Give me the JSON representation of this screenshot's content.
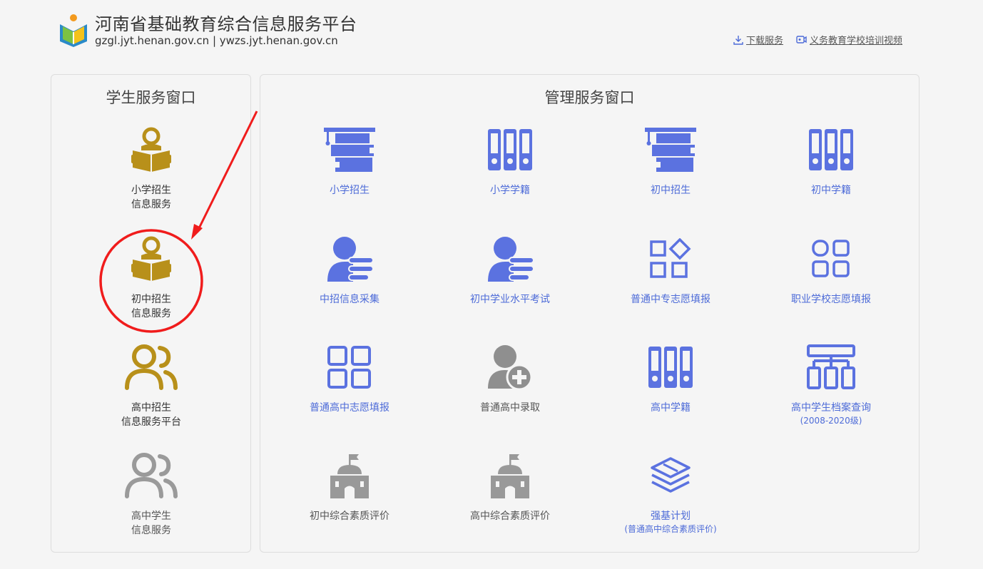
{
  "header": {
    "title": "河南省基础教育综合信息服务平台",
    "domains": "gzgl.jyt.henan.gov.cn | ywzs.jyt.henan.gov.cn",
    "links": [
      {
        "label": "下载服务",
        "icon": "download-icon"
      },
      {
        "label": "义务教育学校培训视频",
        "icon": "video-icon"
      }
    ]
  },
  "student_panel": {
    "title": "学生服务窗口",
    "items": [
      {
        "line1": "小学招生",
        "line2": "信息服务",
        "icon": "reader-icon",
        "color": "#b8901a"
      },
      {
        "line1": "初中招生",
        "line2": "信息服务",
        "icon": "reader-icon",
        "color": "#b8901a"
      },
      {
        "line1": "高中招生",
        "line2": "信息服务平台",
        "icon": "users-icon",
        "color": "#b8901a"
      },
      {
        "line1": "高中学生",
        "line2": "信息服务",
        "icon": "users-icon",
        "color": "#9a9a9a"
      }
    ]
  },
  "manage_panel": {
    "title": "管理服务窗口",
    "items": [
      {
        "label": "小学招生",
        "icon": "graduation-books-icon"
      },
      {
        "label": "小学学籍",
        "icon": "binders-icon"
      },
      {
        "label": "初中招生",
        "icon": "graduation-books-icon"
      },
      {
        "label": "初中学籍",
        "icon": "binders-icon"
      },
      {
        "label": "中招信息采集",
        "icon": "user-list-icon"
      },
      {
        "label": "初中学业水平考试",
        "icon": "user-list-icon"
      },
      {
        "label": "普通中专志愿填报",
        "icon": "shapes-icon"
      },
      {
        "label": "职业学校志愿填报",
        "icon": "squares-icon"
      },
      {
        "label": "普通高中志愿填报",
        "icon": "grid-icon"
      },
      {
        "label": "普通高中录取",
        "icon": "user-add-icon"
      },
      {
        "label": "高中学籍",
        "icon": "binders-icon"
      },
      {
        "label": "高中学生档案查询",
        "sub": "(2008-2020级)",
        "icon": "org-chart-icon"
      },
      {
        "label": "初中综合素质评价",
        "icon": "school-icon"
      },
      {
        "label": "高中综合素质评价",
        "icon": "school-icon"
      },
      {
        "label": "强基计划",
        "sub": "(普通高中综合素质评价)",
        "icon": "layers-icon"
      }
    ]
  },
  "colors": {
    "accent_blue": "#5b72e0",
    "gold": "#b8901a",
    "grey": "#9a9a9a",
    "annotation_red": "#f01c1c"
  }
}
